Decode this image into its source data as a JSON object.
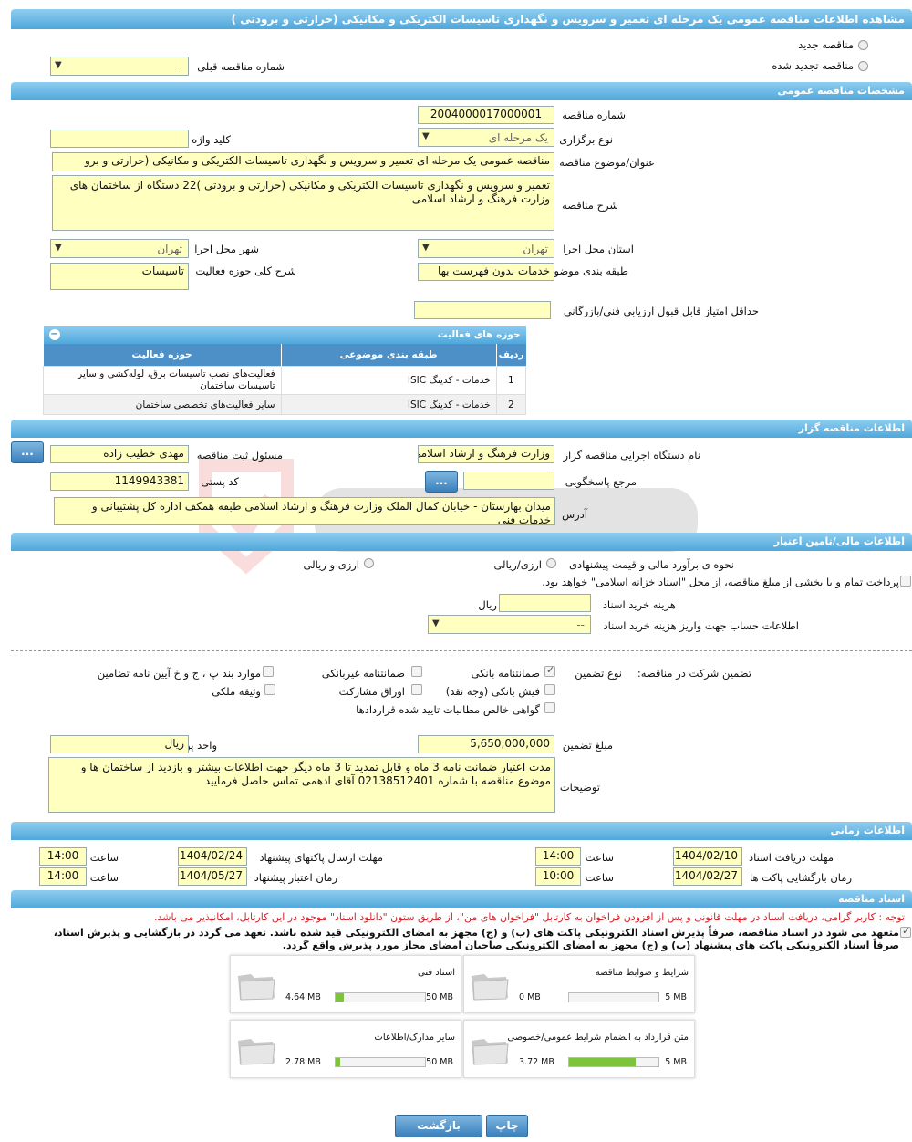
{
  "header": {
    "title": "مشاهده اطلاعات مناقصه عمومی یک مرحله ای تعمیر و سرویس و نگهداری تاسیسات الکتریکی و مکانیکی (حرارتی و برودتی )"
  },
  "tender_type": {
    "new_label": "مناقصه جدید",
    "renewed_label": "مناقصه تجدید شده",
    "previous_label": "شماره مناقصه قبلی",
    "previous_value": "--"
  },
  "general": {
    "section_title": "مشخصات مناقصه عمومی",
    "number_label": "شماره مناقصه",
    "number": "2004000017000001",
    "holding_type_label": "نوع برگزاری",
    "holding_type": "یک مرحله ای",
    "keyword_label": "کلید واژه",
    "keyword": "",
    "subject_label": "عنوان/موضوع مناقصه",
    "subject": "مناقصه عمومی یک مرحله ای تعمیر و سرویس و نگهداری تاسیسات الکتریکی و مکانیکی (حرارتی و برو",
    "description_label": "شرح مناقصه",
    "description": "تعمیر و سرویس و نگهداری تاسیسات الکتریکی و مکانیکی (حرارتی و برودتی )22 دستگاه از ساختمان های وزارت فرهنگ و ارشاد اسلامی",
    "province_label": "استان محل اجرا",
    "province": "تهران",
    "city_label": "شهر محل اجرا",
    "city": "تهران",
    "category_label": "طبقه بندی موضوعی",
    "category": "خدمات بدون فهرست بها",
    "activity_desc_label": "شرح کلی حوزه فعالیت",
    "activity_desc": "تاسیسات",
    "min_score_label": "حداقل امتیاز قابل قبول ارزیابی فنی/بازرگانی",
    "min_score": ""
  },
  "activities": {
    "title": "حوزه های فعالیت",
    "columns": [
      "ردیف",
      "طبقه بندی موضوعی",
      "حوزه فعالیت"
    ],
    "rows": [
      {
        "no": "1",
        "category": "خدمات - کدینگ ISIC",
        "field": "فعالیت‌های نصب تاسیسات برق، لوله‌کشی و سایر تاسیسات ساختمان"
      },
      {
        "no": "2",
        "category": "خدمات - کدینگ ISIC",
        "field": "سایر فعالیت‌های تخصصی ساختمان"
      }
    ]
  },
  "organizer": {
    "section_title": "اطلاعات مناقصه گزار",
    "org_label": "نام دستگاه اجرایی مناقصه گزار",
    "org": "وزارت فرهنگ و ارشاد اسلامی",
    "officer_label": "مسئول ثبت مناقصه",
    "officer": "مهدی خطیب زاده",
    "reference_label": "مرجع پاسخگویی",
    "reference": "",
    "postal_label": "کد پستی",
    "postal": "1149943381",
    "address_label": "آدرس",
    "address": "میدان بهارستان - خیابان کمال الملک وزارت فرهنگ و ارشاد  اسلامی طبقه همکف اداره کل پشتیبانی و خدمات فنی",
    "more_button": "..."
  },
  "finance": {
    "section_title": "اطلاعات مالی/تامین اعتبار",
    "estimate_label": "نحوه ی برآورد مالی و قیمت پیشنهادی",
    "opt_rial": "ارزی/ریالی",
    "opt_fx": "ارزی و ریالی",
    "treasury_text": "پرداخت تمام و یا بخشی از مبلغ مناقصه، از محل \"اسناد خزانه اسلامی\" خواهد بود.",
    "doc_fee_label": "هزینه خرید اسناد",
    "doc_fee": "",
    "doc_fee_unit": "ریال",
    "account_label": "اطلاعات حساب جهت واریز هزینه خرید اسناد",
    "account": "--"
  },
  "guarantee": {
    "label": "تضمین شرکت در مناقصه:",
    "type_label": "نوع تضمین",
    "options": {
      "bank": "ضمانتنامه بانکی",
      "nonbank": "ضمانتنامه غیربانکی",
      "rules": "موارد بند پ ، ج و خ آیین نامه تضامین",
      "cheque": "فیش بانکی (وجه نقد)",
      "bonds": "اوراق مشارکت",
      "property": "وثیقه ملکی",
      "claims": "گواهی خالص مطالبات تایید شده قراردادها"
    },
    "amount_label": "مبلغ تضمین",
    "amount": "5,650,000,000",
    "currency_label": "واحد پول",
    "currency": "ریال",
    "notes_label": "توضیحات",
    "notes": "مدت اعتبار ضمانت نامه 3 ماه و قابل تمدید تا 3 ماه دیگر جهت اطلاعات بیشتر و بازدید از ساختمان ها و موضوع مناقصه با شماره 02138512401 آقای ادهمی تماس حاصل فرمایید"
  },
  "timing": {
    "section_title": "اطلاعات زمانی",
    "receive_label": "مهلت دریافت اسناد",
    "receive_date": "1404/02/10",
    "receive_time": "14:00",
    "send_label": "مهلت ارسال پاکتهای پیشنهاد",
    "send_date": "1404/02/24",
    "send_time": "14:00",
    "open_label": "زمان بازگشایی پاکت ها",
    "open_date": "1404/02/27",
    "open_time": "10:00",
    "validity_label": "زمان اعتبار پیشنهاد",
    "validity_date": "1404/05/27",
    "validity_time": "14:00",
    "time_label": "ساعت"
  },
  "documents": {
    "section_title": "اسناد مناقصه",
    "notice": "توجه : کاربر گرامی، دریافت اسناد در مهلت قانونی و پس از افزودن فراخوان به کارتابل \"فراخوان های من\"، از طریق ستون \"دانلود اسناد\" موجود در این کارتابل، امکانپذیر می باشد.",
    "commitment_1": "متعهد می شود در اسناد مناقصه، صرفاً پذیرش اسناد الکترونیکی پاکت های (ب) و (ج) مجهز به امضای الکترونیکی قید شده باشد. تعهد می گردد در بازگشایی و پذیرش اسناد،",
    "commitment_2": "صرفاً اسناد الکترونیکی پاکت های پیشنهاد (ب) و (ج) مجهز به امضای الکترونیکی صاحبان امضای مجاز مورد پذیرش واقع گردد.",
    "files": [
      {
        "name": "شرایط و ضوابط مناقصه",
        "size": "0 MB",
        "max": "5 MB",
        "ratio": 0
      },
      {
        "name": "اسناد فنی",
        "size": "4.64 MB",
        "max": "50 MB",
        "ratio": 0.093
      },
      {
        "name": "متن قرارداد به انضمام شرایط عمومی/خصوصی",
        "size": "3.72 MB",
        "max": "5 MB",
        "ratio": 0.744
      },
      {
        "name": "سایر مدارک/اطلاعات",
        "size": "2.78 MB",
        "max": "50 MB",
        "ratio": 0.056
      }
    ]
  },
  "actions": {
    "print": "چاپ",
    "back": "بازگشت"
  },
  "colors": {
    "header": "#4fa7db",
    "field": "#ffffc0",
    "progress": "#7dc43a",
    "notice": "#d0222a"
  }
}
